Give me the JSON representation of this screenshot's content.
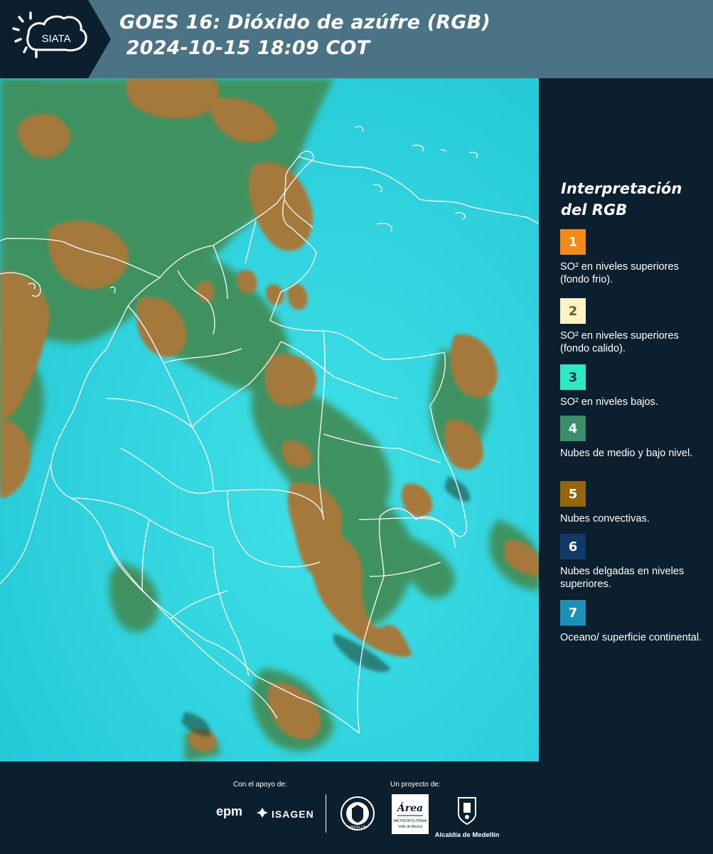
{
  "header": {
    "logo_text": "SIATA",
    "title_line1": "GOES 16: Dióxido de azúfre (RGB)",
    "title_line2": " 2024-10-15 18:09 COT",
    "background": "#4a7385"
  },
  "legend": {
    "title_line1": "Interpretación",
    "title_line2": "del RGB",
    "items": [
      {
        "number": "1",
        "label": "SO² en niveles superiores (fondo frio).",
        "color": "#f28a1a",
        "text_color": "#ffffff"
      },
      {
        "number": "2",
        "label": "SO² en niveles superiores (fondo calido).",
        "color": "#fdf4c2",
        "text_color": "#6b5a2a"
      },
      {
        "number": "3",
        "label": "SO² en niveles bajos.",
        "color": "#2ee8c8",
        "text_color": "#0c3a3a"
      },
      {
        "number": "4",
        "label": "Nubes de medio y bajo nivel.",
        "color": "#3a8f6a",
        "text_color": "#ffffff"
      },
      {
        "number": "5",
        "label": "Nubes convectivas.",
        "color": "#94640f",
        "text_color": "#ffffff"
      },
      {
        "number": "6",
        "label": "Nubes delgadas en niveles superiores.",
        "color": "#103a6a",
        "text_color": "#ffffff"
      },
      {
        "number": "7",
        "label": "Oceano/ superficie continental.",
        "color": "#1991b8",
        "text_color": "#ffffff"
      }
    ]
  },
  "footer": {
    "support_label": "Con el apoyo de:",
    "project_label": "Un proyecto de:",
    "epm": "epm",
    "isagen": "ISAGEN",
    "area_top": "Área",
    "area_metro": "METROPOLITANA",
    "area_valle": "Valle de Aburrá",
    "seal_text": "MEDELLÍN",
    "alcaldia": "Alcaldía de Medellín"
  },
  "map": {
    "ocean_color": "#2fd0de",
    "cloud_mid_color": "#3f8f5a",
    "convective_color": "#a5793a",
    "border_color": "#ffffff"
  }
}
